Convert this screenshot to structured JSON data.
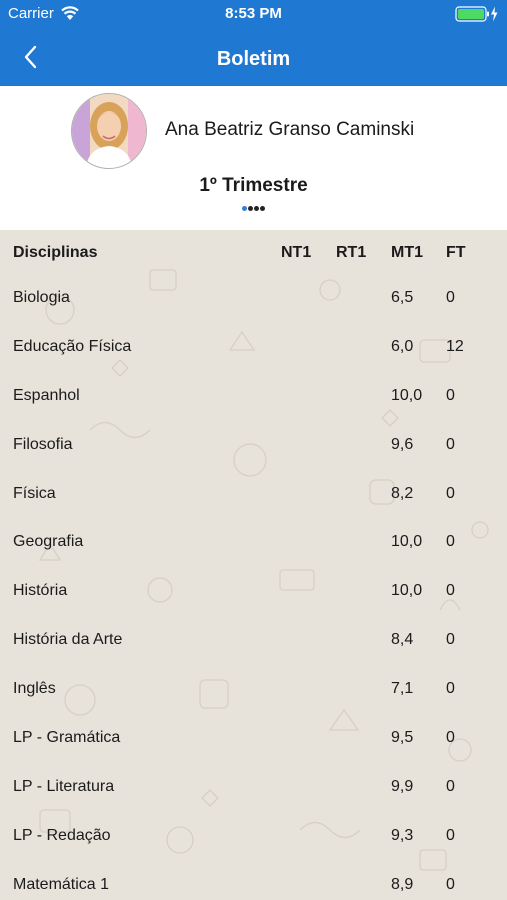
{
  "status_bar": {
    "carrier": "Carrier",
    "time": "8:53 PM",
    "icons": [
      "wifi-icon",
      "battery-icon"
    ]
  },
  "nav": {
    "title": "Boletim",
    "back_icon": "chevron-left-icon"
  },
  "profile": {
    "name": "Ana Beatriz Granso Caminski",
    "period": "1º Trimestre",
    "page_indicator": {
      "count": 4,
      "active": 0
    }
  },
  "table": {
    "headers": {
      "subject": "Disciplinas",
      "nt1": "NT1",
      "rt1": "RT1",
      "mt1": "MT1",
      "ft": "FT"
    },
    "rows": [
      {
        "subject": "Biologia",
        "nt1": "",
        "rt1": "",
        "mt1": "6,5",
        "ft": "0"
      },
      {
        "subject": "Educação Física",
        "nt1": "",
        "rt1": "",
        "mt1": "6,0",
        "ft": "12"
      },
      {
        "subject": "Espanhol",
        "nt1": "",
        "rt1": "",
        "mt1": "10,0",
        "ft": "0"
      },
      {
        "subject": "Filosofia",
        "nt1": "",
        "rt1": "",
        "mt1": "9,6",
        "ft": "0"
      },
      {
        "subject": "Física",
        "nt1": "",
        "rt1": "",
        "mt1": "8,2",
        "ft": "0"
      },
      {
        "subject": "Geografia",
        "nt1": "",
        "rt1": "",
        "mt1": "10,0",
        "ft": "0"
      },
      {
        "subject": "História",
        "nt1": "",
        "rt1": "",
        "mt1": "10,0",
        "ft": "0"
      },
      {
        "subject": "História da Arte",
        "nt1": "",
        "rt1": "",
        "mt1": "8,4",
        "ft": "0"
      },
      {
        "subject": "Inglês",
        "nt1": "",
        "rt1": "",
        "mt1": "7,1",
        "ft": "0"
      },
      {
        "subject": "LP - Gramática",
        "nt1": "",
        "rt1": "",
        "mt1": "9,5",
        "ft": "0"
      },
      {
        "subject": "LP - Literatura",
        "nt1": "",
        "rt1": "",
        "mt1": "9,9",
        "ft": "0"
      },
      {
        "subject": "LP - Redação",
        "nt1": "",
        "rt1": "",
        "mt1": "9,3",
        "ft": "0"
      },
      {
        "subject": "Matemática 1",
        "nt1": "",
        "rt1": "",
        "mt1": "8,9",
        "ft": "0"
      }
    ]
  },
  "colors": {
    "primary": "#1f78d1",
    "table_background": "#e7e2da",
    "active_dot": "#2f7fd6",
    "battery": "#4cd964"
  }
}
